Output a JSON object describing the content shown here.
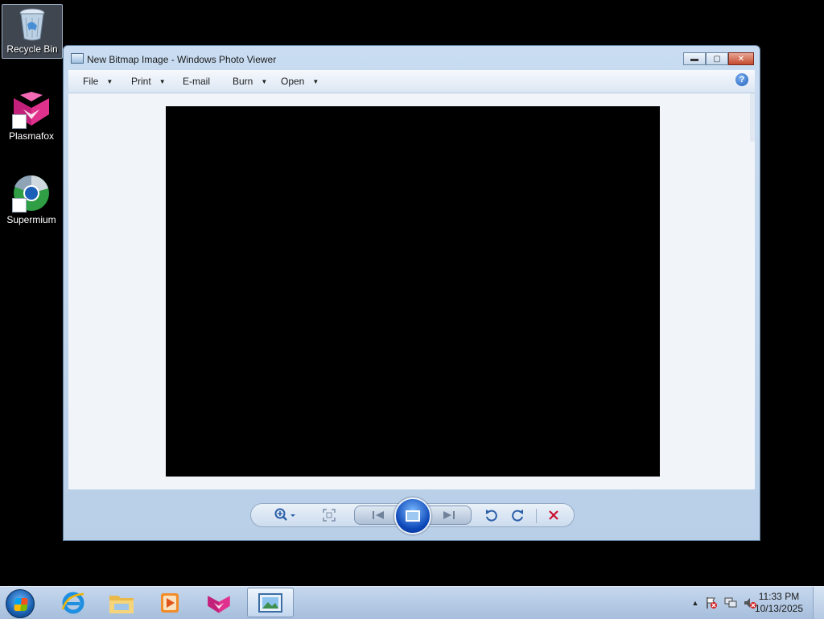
{
  "desktop": {
    "icons": [
      {
        "label": "Recycle Bin",
        "icon": "recycle-bin-icon"
      },
      {
        "label": "Plasmafox",
        "icon": "plasmafox-icon"
      },
      {
        "label": "Supermium",
        "icon": "supermium-icon"
      }
    ]
  },
  "window": {
    "title": "New Bitmap Image - Windows Photo Viewer",
    "menu": [
      {
        "label": "File",
        "has_dropdown": true
      },
      {
        "label": "Print",
        "has_dropdown": true
      },
      {
        "label": "E-mail",
        "has_dropdown": false
      },
      {
        "label": "Burn",
        "has_dropdown": true
      },
      {
        "label": "Open",
        "has_dropdown": true
      }
    ],
    "help_glyph": "?",
    "image_color": "#000000",
    "controls": [
      "zoom-icon",
      "actual-size-icon",
      "previous-icon",
      "slideshow-icon",
      "next-icon",
      "rotate-counterclockwise-icon",
      "rotate-clockwise-icon",
      "delete-icon"
    ]
  },
  "taskbar": {
    "pinned": [
      "internet-explorer-icon",
      "file-explorer-icon",
      "media-player-icon",
      "plasmafox-icon",
      "photo-viewer-icon"
    ],
    "active_app": "photo-viewer-icon",
    "clock": {
      "time": "11:33 PM",
      "date": "10/13/2025"
    }
  },
  "colors": {
    "accent": "#1e5fbd",
    "close_red": "#c44a2d",
    "delete_red": "#c8102e"
  }
}
